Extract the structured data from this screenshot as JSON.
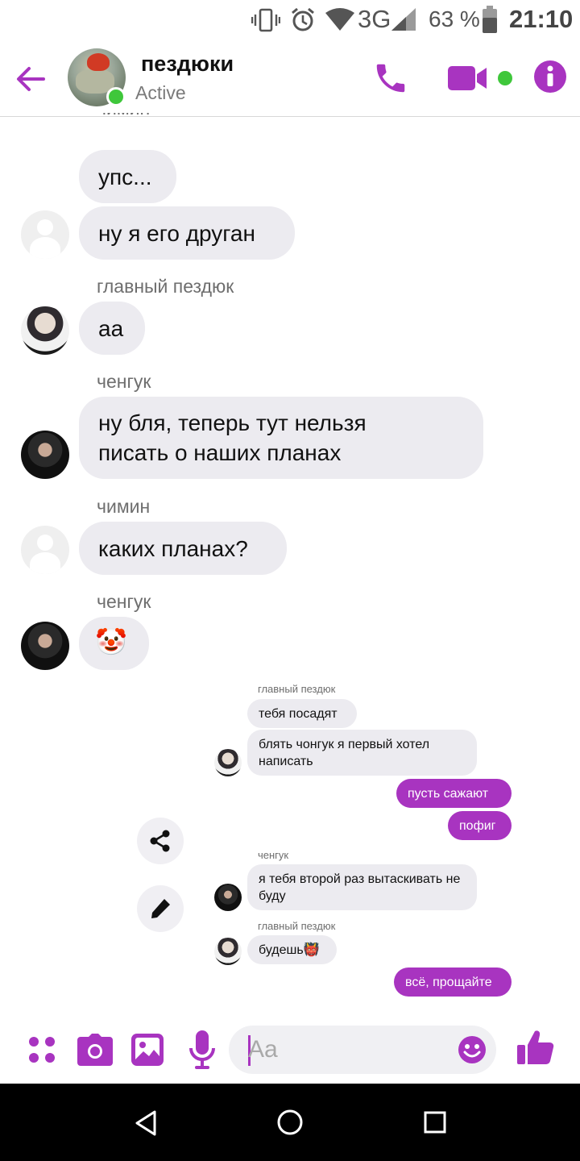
{
  "status_bar": {
    "network": "3G",
    "battery": "63 %",
    "time": "21:10"
  },
  "header": {
    "title": "пездюки",
    "status": "Active"
  },
  "messages_large": [
    {
      "sender": "",
      "text": "упс..."
    },
    {
      "sender": "",
      "text": "ну я его друган"
    },
    {
      "sender": "главный пездюк",
      "text": "аа"
    },
    {
      "sender": "ченгук",
      "text": "ну бля, теперь тут нельзя писать о наших планах"
    },
    {
      "sender": "чимин",
      "text": "каких планах?"
    },
    {
      "sender": "ченгук",
      "text": "🤡"
    }
  ],
  "messages_small": [
    {
      "sender": "главный пездюк",
      "text": "тебя посадят"
    },
    {
      "sender": "",
      "text": "блять чонгук я первый хотел написать"
    },
    {
      "sender": "",
      "text": "пусть сажают"
    },
    {
      "sender": "",
      "text": "пофиг"
    },
    {
      "sender": "ченгук",
      "text": "я тебя второй раз вытаскивать не буду"
    },
    {
      "sender": "главный пездюк",
      "text": "будешь👹"
    },
    {
      "sender": "",
      "text": "всё, прощайте"
    }
  ],
  "composer": {
    "placeholder": "Aa"
  },
  "colors": {
    "accent": "#a834c0",
    "online": "#3fc73b",
    "bubble_in": "#ecebf0"
  },
  "icons": [
    "vibrate-icon",
    "alarm-icon",
    "wifi-icon",
    "signal-icon",
    "battery-icon",
    "back-arrow-icon",
    "phone-icon",
    "video-icon",
    "info-icon",
    "share-icon",
    "pen-icon",
    "apps-icon",
    "camera-icon",
    "gallery-icon",
    "microphone-icon",
    "emoji-icon",
    "thumbs-up-icon",
    "nav-back-icon",
    "nav-home-icon",
    "nav-recents-icon"
  ]
}
